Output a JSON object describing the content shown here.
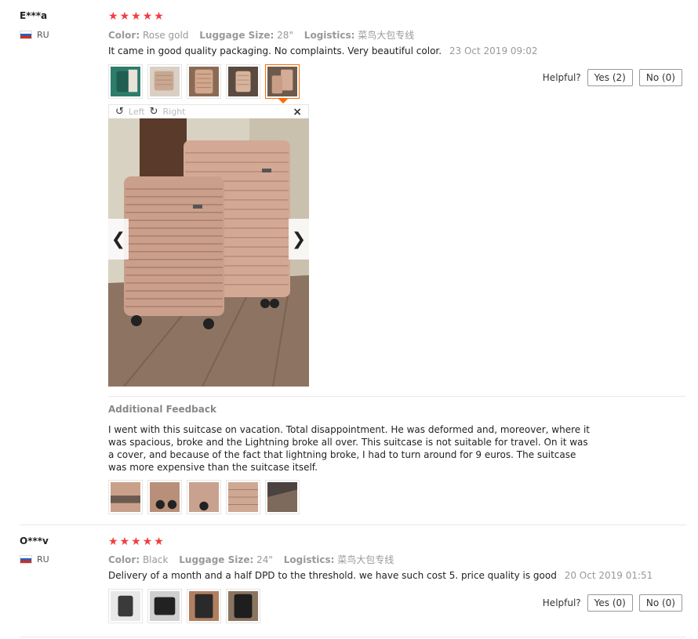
{
  "reviews": [
    {
      "user": "E***a",
      "country": "RU",
      "stars": [
        "★",
        "★",
        "★",
        "★",
        "★"
      ],
      "attributes": [
        {
          "key": "Color:",
          "value": "Rose gold"
        },
        {
          "key": "Luggage Size:",
          "value": "28\""
        },
        {
          "key": "Logistics:",
          "value": "菜鸟大包专线"
        }
      ],
      "text": "It came in good quality packaging. No complaints. Very beautiful color.",
      "date": "23 Oct 2019 09:02",
      "helpful_label": "Helpful?",
      "yes_label": "Yes (2)",
      "no_label": "No (0)",
      "viewer": {
        "rotate_left": "Left",
        "rotate_right": "Right",
        "close": "×",
        "prev": "❮",
        "next": "❯"
      },
      "additional": {
        "title": "Additional Feedback",
        "text": "I went with this suitcase on vacation. Total disappointment. He was deformed and, moreover, where it was spacious, broke and the Lightning broke all over. This suitcase is not suitable for travel. On it was a cover, and because of the fact that lightning broke, I had to turn around for 9 euros. The suitcase was more expensive than the suitcase itself."
      }
    },
    {
      "user": "O***v",
      "country": "RU",
      "stars": [
        "★",
        "★",
        "★",
        "★",
        "★"
      ],
      "attributes": [
        {
          "key": "Color:",
          "value": "Black"
        },
        {
          "key": "Luggage Size:",
          "value": "24\""
        },
        {
          "key": "Logistics:",
          "value": "菜鸟大包专线"
        }
      ],
      "text": "Delivery of a month and a half DPD to the threshold. we have such cost 5. price quality is good",
      "date": "20 Oct 2019 01:51",
      "helpful_label": "Helpful?",
      "yes_label": "Yes (0)",
      "no_label": "No (0)"
    }
  ],
  "colors": {
    "star": "#f23d3d",
    "active_thumb": "#ff6a00"
  }
}
